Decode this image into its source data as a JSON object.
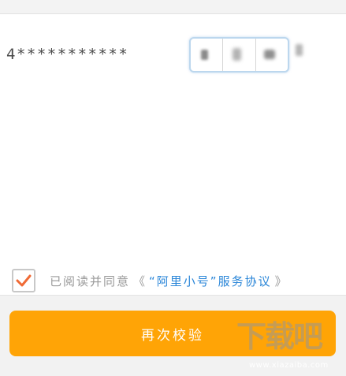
{
  "account": {
    "masked_number": "4***********"
  },
  "agreement": {
    "checked": true,
    "prefix": "已阅读并同意",
    "open_quote": "《",
    "link": "“阿里小号”服务协议",
    "close_quote": "》"
  },
  "action": {
    "button_label": "再次校验"
  },
  "watermark": {
    "logo": "下载吧",
    "url": "www.xiazaiba.com"
  },
  "colors": {
    "accent": "#ffa406",
    "link": "#2a86d8",
    "check": "#f06a35"
  }
}
